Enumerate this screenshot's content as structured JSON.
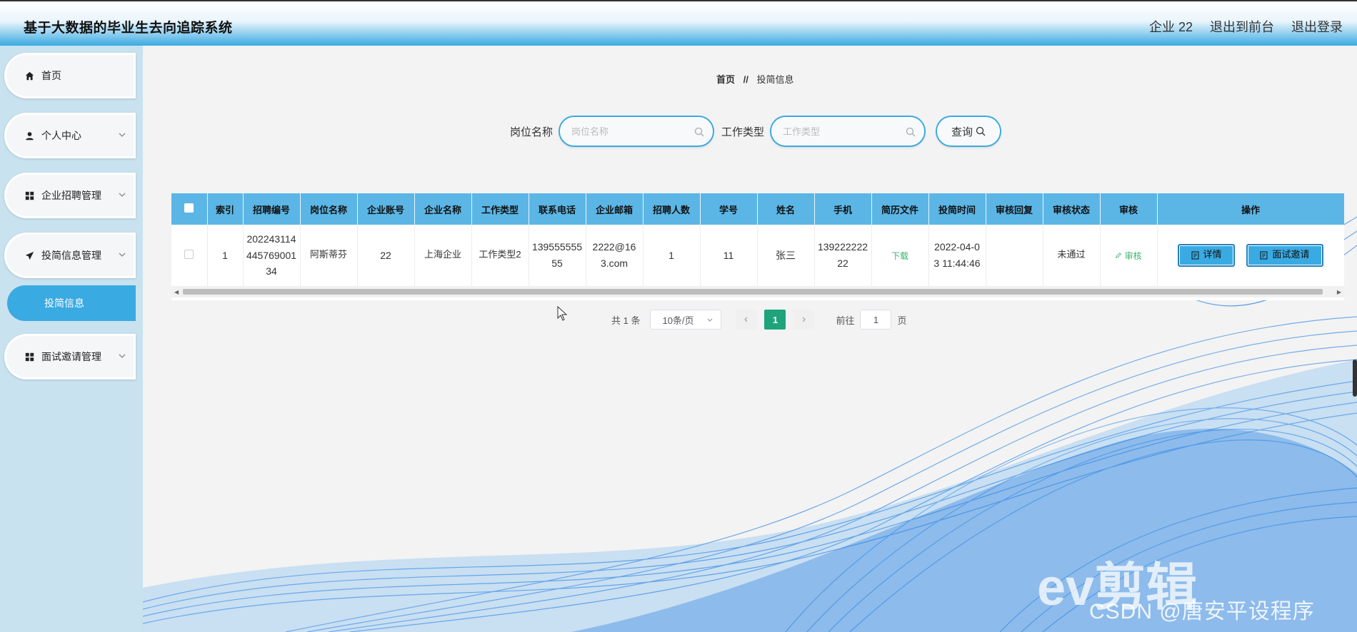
{
  "header": {
    "title": "基于大数据的毕业生去向追踪系统",
    "user": "企业 22",
    "to_front": "退出到前台",
    "logout": "退出登录"
  },
  "sidebar": {
    "items": [
      {
        "label": "首页",
        "icon": "home-icon"
      },
      {
        "label": "个人中心",
        "icon": "user-icon"
      },
      {
        "label": "企业招聘管理",
        "icon": "grid-icon"
      },
      {
        "label": "投简信息管理",
        "icon": "send-icon"
      },
      {
        "label": "面试邀请管理",
        "icon": "grid-icon"
      }
    ],
    "active_sub": "投简信息"
  },
  "breadcrumb": {
    "home": "首页",
    "sep": "//",
    "current": "投简信息"
  },
  "search": {
    "job_label": "岗位名称",
    "job_placeholder": "岗位名称",
    "type_label": "工作类型",
    "type_placeholder": "工作类型",
    "button": "查询"
  },
  "table": {
    "headers": [
      "索引",
      "招聘编号",
      "岗位名称",
      "企业账号",
      "企业名称",
      "工作类型",
      "联系电话",
      "企业邮箱",
      "招聘人数",
      "学号",
      "姓名",
      "手机",
      "简历文件",
      "投简时间",
      "审核回复",
      "审核状态",
      "审核",
      "操作"
    ],
    "row": {
      "index": "1",
      "recruit_no": "20224311444576900134",
      "job_name": "阿斯蒂芬",
      "company_account": "22",
      "company_name": "上海企业",
      "job_type": "工作类型2",
      "contact_phone": "13955555555",
      "company_email": "2222@163.com",
      "recruit_count": "1",
      "student_no": "11",
      "name": "张三",
      "mobile": "13922222222",
      "resume": "下载",
      "apply_time": "2022-04-03 11:44:46",
      "review_reply": "",
      "review_status": "未通过",
      "review_action": "审核",
      "detail_btn": "详情",
      "invite_btn": "面试邀请"
    }
  },
  "pager": {
    "total": "共 1 条",
    "page_size": "10条/页",
    "current": "1",
    "goto_label": "前往",
    "goto_value": "1",
    "page_suffix": "页"
  },
  "watermark": {
    "text": "CSDN @唐安平设程序",
    "logo": "ev剪辑"
  },
  "colors": {
    "accent": "#3aaae2",
    "current_page": "#1fa37b",
    "link_green": "#3cb371"
  }
}
